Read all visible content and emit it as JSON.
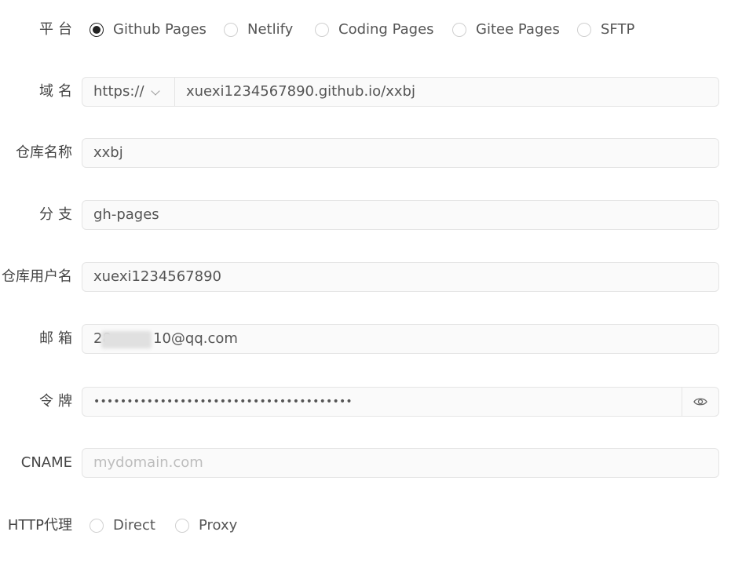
{
  "form": {
    "platform": {
      "label": "平台",
      "options": [
        {
          "label": "Github Pages",
          "checked": true
        },
        {
          "label": "Netlify",
          "checked": false
        },
        {
          "label": "Coding Pages",
          "checked": false
        },
        {
          "label": "Gitee Pages",
          "checked": false
        },
        {
          "label": "SFTP",
          "checked": false
        }
      ]
    },
    "domain": {
      "label": "域名",
      "protocol": "https://",
      "value": "xuexi1234567890.github.io/xxbj"
    },
    "repo": {
      "label": "仓库名称",
      "value": "xxbj"
    },
    "branch": {
      "label": "分支",
      "value": "gh-pages"
    },
    "username": {
      "label": "仓库用户名",
      "value": "xuexi1234567890"
    },
    "email": {
      "label": "邮箱",
      "value_prefix": "28",
      "value_suffix": "10@qq.com"
    },
    "token": {
      "label": "令牌",
      "value": "•••••••••••••••••••••••••••••••••••••••"
    },
    "cname": {
      "label": "CNAME",
      "placeholder": "mydomain.com"
    },
    "proxy": {
      "label": "HTTP代理",
      "options": [
        {
          "label": "Direct",
          "checked": false
        },
        {
          "label": "Proxy",
          "checked": false
        }
      ]
    }
  }
}
